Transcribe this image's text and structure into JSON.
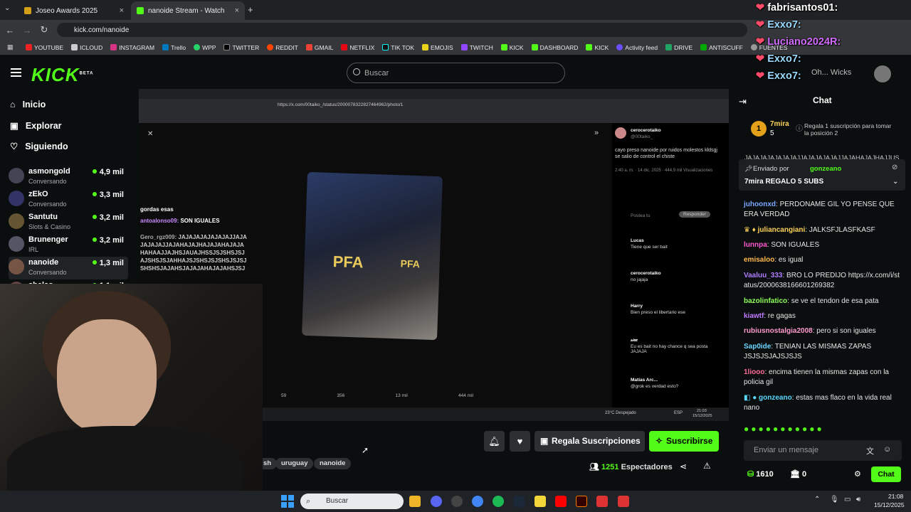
{
  "browser": {
    "tabs": [
      {
        "label": "Joseo Awards 2025",
        "close": "×"
      },
      {
        "label": "nanoide Stream - Watch Live o",
        "close": "×"
      }
    ],
    "new_tab": "+",
    "url": "kick.com/nanoide",
    "bookmarks": [
      "YOUTUBE",
      "ICLOUD",
      "INSTAGRAM",
      "Trello",
      "WPP",
      "TWITTER",
      "REDDIT",
      "GMAIL",
      "NETFLIX",
      "TIK TOK",
      "EMOJIS",
      "TWITCH",
      "KICK",
      "DASHBOARD",
      "KICK",
      "Activity feed",
      "DRIVE",
      "ANTISCUFF",
      "FUENTES"
    ]
  },
  "kick": {
    "logo": "KICK",
    "logo_beta": "BETA",
    "search_placeholder": "Buscar"
  },
  "sidebar": {
    "nav": [
      {
        "label": "Inicio"
      },
      {
        "label": "Explorar"
      },
      {
        "label": "Siguiendo"
      }
    ],
    "channels": [
      {
        "name": "asmongold",
        "category": "Conversando",
        "viewers": "4,9 mil"
      },
      {
        "name": "zEkO",
        "category": "Conversando",
        "viewers": "3,3 mil"
      },
      {
        "name": "Santutu",
        "category": "Slots & Casino",
        "viewers": "3,2 mil"
      },
      {
        "name": "Brunenger",
        "category": "IRL",
        "viewers": "3,2 mil"
      },
      {
        "name": "nanoide",
        "category": "Conversando",
        "viewers": "1,3 mil"
      },
      {
        "name": "shelao",
        "category": "",
        "viewers": "1,1 mil"
      }
    ]
  },
  "stream_capture": {
    "inner_url": "https://x.com/00taiko_/status/2000078322827464962/photo/1",
    "tweet_author": "cerocerotaiko",
    "tweet_handle": "@00taiko_",
    "tweet_text": "cayo preso nanoide por ruidos molestos kldsgj se salio de control el chiste",
    "tweet_meta": "2:40 a. m. · 14 dic. 2025 · 444,9 mil Visualizaciones",
    "reply_placeholder": "Postea tu",
    "reply_button": "Responder",
    "replies": [
      {
        "author": "Lucas",
        "text": "Tiene que ser bait"
      },
      {
        "author": "cerocerotaiko",
        "text": "no jajaja"
      },
      {
        "author": "Harry",
        "text": "Bien preso el libertario ese"
      },
      {
        "author": "𝓈𝒾𝑒𝑒",
        "text": "Eu es bait no hay chance q sea posta JAJAJA"
      },
      {
        "author": "Matías Arc...",
        "text": "@grok es verdad esto?"
      }
    ],
    "photo_text": "PFA",
    "photo_stats": [
      "59",
      "356",
      "13 mil",
      "444 mil"
    ],
    "overlay_chat": [
      {
        "user": "",
        "text": "gordas esas"
      },
      {
        "user": "antoalonso09:",
        "text": "SON IGUALES"
      },
      {
        "user": "Gero_rgz009:",
        "text": "JAJAJAJAJAJAJAJJAJAJAJAJAJJAJAHAJAJHAJAJAHAJAJAHAHAAJJAJHSJAUAJHSSJSJSHSJSJAJSHSJSJAHHAJSJSHSJSJSHSJSJSJSHSHSJAJAHSJAJAJAHAJAJAHSJSJJSAJJAJAJAJ"
      }
    ],
    "taskbar_weather": "23°C Despejado",
    "taskbar_lang": "ESP",
    "taskbar_time": "21:03",
    "taskbar_date": "15/12/2025"
  },
  "below_stream": {
    "tags": [
      "sh",
      "uruguay",
      "nanoide"
    ],
    "gift_button": "Regala Suscripciones",
    "subscribe_button": "Suscribirse",
    "viewers": "1251",
    "viewers_label": "Espectadores"
  },
  "overlay_alerts": [
    {
      "user": "fabrisantos01:",
      "color": "#ffffff"
    },
    {
      "user": "Exxo7:",
      "color": "#9ad9ff"
    },
    {
      "user": "Luciano2024R:",
      "color": "#d26bff"
    },
    {
      "user": "Exxo7:",
      "color": "#9ad9ff"
    },
    {
      "user": "Exxo7:",
      "color": "#9ad9ff"
    }
  ],
  "login_hint": "Oh... Wicks",
  "chat": {
    "title": "Chat",
    "leader": {
      "name": "7mira",
      "count": "5",
      "rank": "1",
      "info": "Regala 1 suscripción para tomar la posición 2"
    },
    "scroll_text": "JAJAJAJAJAJAJAJJAJAJAJAJAJJAJAHAJAJHAJJUS",
    "pinned": {
      "by_label": "Enviado por",
      "by_user": "gonzeano",
      "message": "7mira REGALO 5 SUBS"
    },
    "messages": [
      {
        "user": "juhoonxd",
        "color": "#7aa7ff",
        "text": "PERDONAME GIL YO PENSE QUE ERA VERDAD"
      },
      {
        "user": "juliancangiani",
        "color": "#ffd35a",
        "text": "JALKSFJLASFKASF"
      },
      {
        "user": "lunnpa",
        "color": "#ff5ad1",
        "text": "SON IGUALES"
      },
      {
        "user": "emisaloo",
        "color": "#ffb84d",
        "text": "es igual"
      },
      {
        "user": "Vaaluu_333",
        "color": "#b07cff",
        "text": "BRO LO PREDIJO https://x.com/i/status/2000638166601269382"
      },
      {
        "user": "bazolinfatico",
        "color": "#8dff5a",
        "text": "se ve el tendon de esa pata"
      },
      {
        "user": "kiawtf",
        "color": "#c07bff",
        "text": "re gagas"
      },
      {
        "user": "rubiusnostalgia2008",
        "color": "#ff9ad0",
        "text": "pero si son iguales"
      },
      {
        "user": "Sap0ide",
        "color": "#6bd6ff",
        "text": "TENIAN LAS MISMAS ZAPAS JSJSJSJAJSJSJS"
      },
      {
        "user": "1liooo",
        "color": "#ff6b9a",
        "text": "encima tienen la mismas zapas con la policia gil"
      },
      {
        "user": "gonzeano",
        "color": "#5ad8ff",
        "text": "estas mas flaco en la vida real nano"
      }
    ],
    "input_placeholder": "Enviar un mensaje",
    "points": "1610",
    "other_count": "0",
    "send_button": "Chat"
  },
  "taskbar": {
    "search_placeholder": "Buscar",
    "time": "21:08",
    "date": "15/12/2025"
  },
  "colors": {
    "kick_green": "#53fc18",
    "background": "#0b0e0f"
  }
}
